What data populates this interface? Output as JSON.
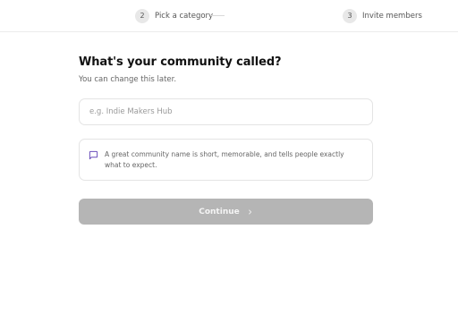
{
  "steps": [
    {
      "number": "2",
      "label": "Pick a category"
    },
    {
      "number": "3",
      "label": "Invite members"
    }
  ],
  "form": {
    "title": "What's your community called?",
    "subtitle": "You can change this later.",
    "name_input": {
      "placeholder": "e.g. Indie Makers Hub",
      "value": ""
    },
    "tip": {
      "icon": "message-square-icon",
      "text": "A great community name is short, memorable, and tells people exactly what to expect."
    },
    "continue_label": "Continue",
    "continue_icon": "chevron-right-icon"
  },
  "colors": {
    "accent": "#6b4fbb",
    "button_disabled": "#b5b5b5"
  }
}
